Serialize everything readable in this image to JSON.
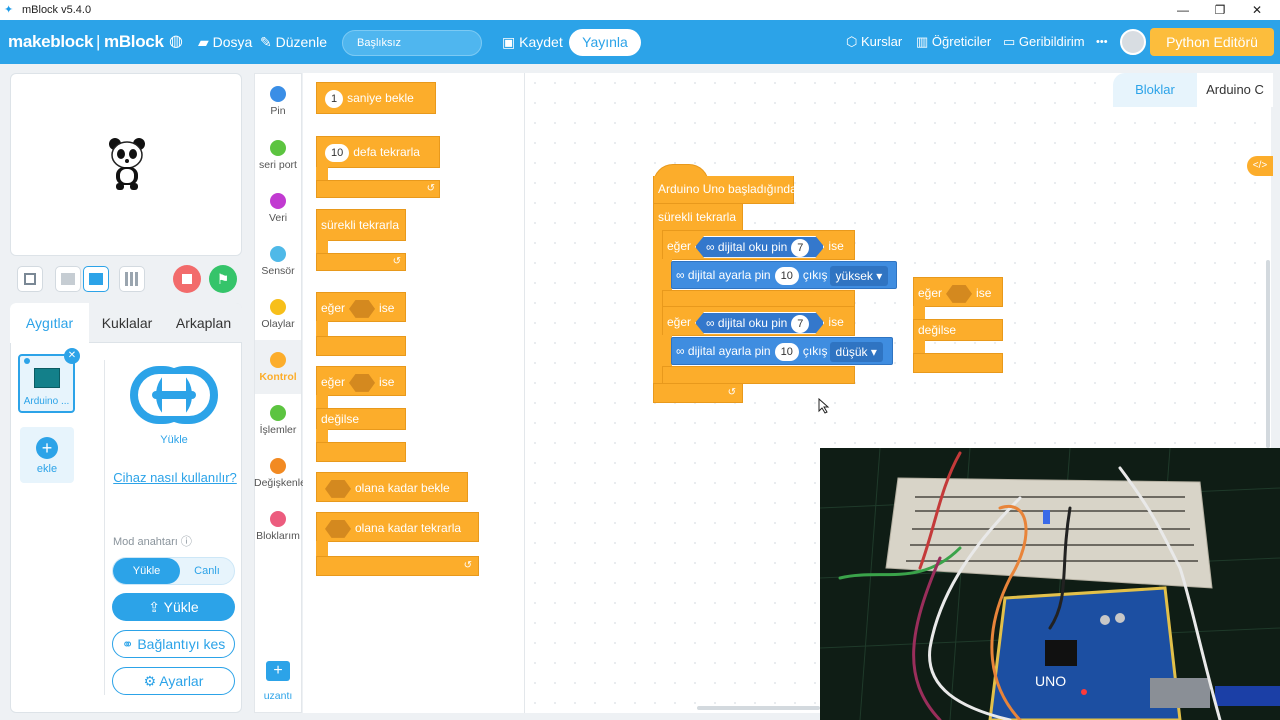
{
  "window": {
    "title": "mBlock v5.4.0",
    "minimize": "—",
    "restore": "❐",
    "close": "✕"
  },
  "menubar": {
    "logo_left": "makeblock",
    "logo_right": "mBlock",
    "file": "Dosya",
    "edit": "Düzenle",
    "project_name": "Başlıksız",
    "save": "Kaydet",
    "publish": "Yayınla",
    "courses": "Kurslar",
    "tutorials": "Öğreticiler",
    "feedback": "Geribildirim",
    "more": "•••",
    "python_editor": "Python Editörü"
  },
  "left_panel": {
    "tabs": [
      "Aygıtlar",
      "Kuklalar",
      "Arkaplan"
    ],
    "active_tab": "Aygıtlar",
    "device_name": "Arduino ...",
    "add_label": "ekle",
    "upload_icon_label": "Yükle",
    "help_link": "Cihaz nasıl kullanılır?",
    "mode_label": "Mod anahtarı",
    "mode_options": [
      "Yükle",
      "Canlı"
    ],
    "mode_selected": "Yükle",
    "upload_button": "Yükle",
    "disconnect_button": "Bağlantıyı kes",
    "settings_button": "Ayarlar"
  },
  "categories": [
    {
      "label": "Pin",
      "color": "#3a8ee6"
    },
    {
      "label": "seri port",
      "color": "#5cc440"
    },
    {
      "label": "Veri",
      "color": "#c13ad1"
    },
    {
      "label": "Sensör",
      "color": "#4fb9e8"
    },
    {
      "label": "Olaylar",
      "color": "#f7bf1a"
    },
    {
      "label": "Kontrol",
      "color": "#fcad2b"
    },
    {
      "label": "İşlemler",
      "color": "#5cc440"
    },
    {
      "label": "Değişkenle",
      "color": "#f28a22"
    },
    {
      "label": "Bloklarım",
      "color": "#ec5c7e"
    }
  ],
  "active_category": "Kontrol",
  "extension_label": "uzantı",
  "palette": {
    "wait_num": "1",
    "wait_label": "saniye bekle",
    "repeat_num": "10",
    "repeat_label": "defa tekrarla",
    "forever_label": "sürekli tekrarla",
    "if_label": "eğer",
    "then_label": "ise",
    "else_label": "değilse",
    "wait_until_label": "olana kadar bekle",
    "repeat_until_label": "olana kadar tekrarla"
  },
  "script": {
    "hat": "Arduino Uno başladığında",
    "forever": "sürekli tekrarla",
    "if1": {
      "if_label": "eğer",
      "read_label": "dijital oku pin",
      "read_pin": "7",
      "then_label": "ise",
      "set_label": "dijital ayarla pin",
      "set_pin": "10",
      "out_label": "çıkış",
      "level": "yüksek ▾"
    },
    "if2": {
      "if_label": "eğer",
      "read_label": "dijital oku pin",
      "read_pin": "7",
      "then_label": "ise",
      "set_label": "dijital ayarla pin",
      "set_pin": "10",
      "out_label": "çıkış",
      "level": "düşük ▾"
    },
    "loose": {
      "if_label": "eğer",
      "then_label": "ise",
      "else_label": "değilse"
    }
  },
  "right_tabs": {
    "blocks": "Bloklar",
    "code": "Arduino C"
  },
  "photo": {
    "board_label": "UNO"
  }
}
